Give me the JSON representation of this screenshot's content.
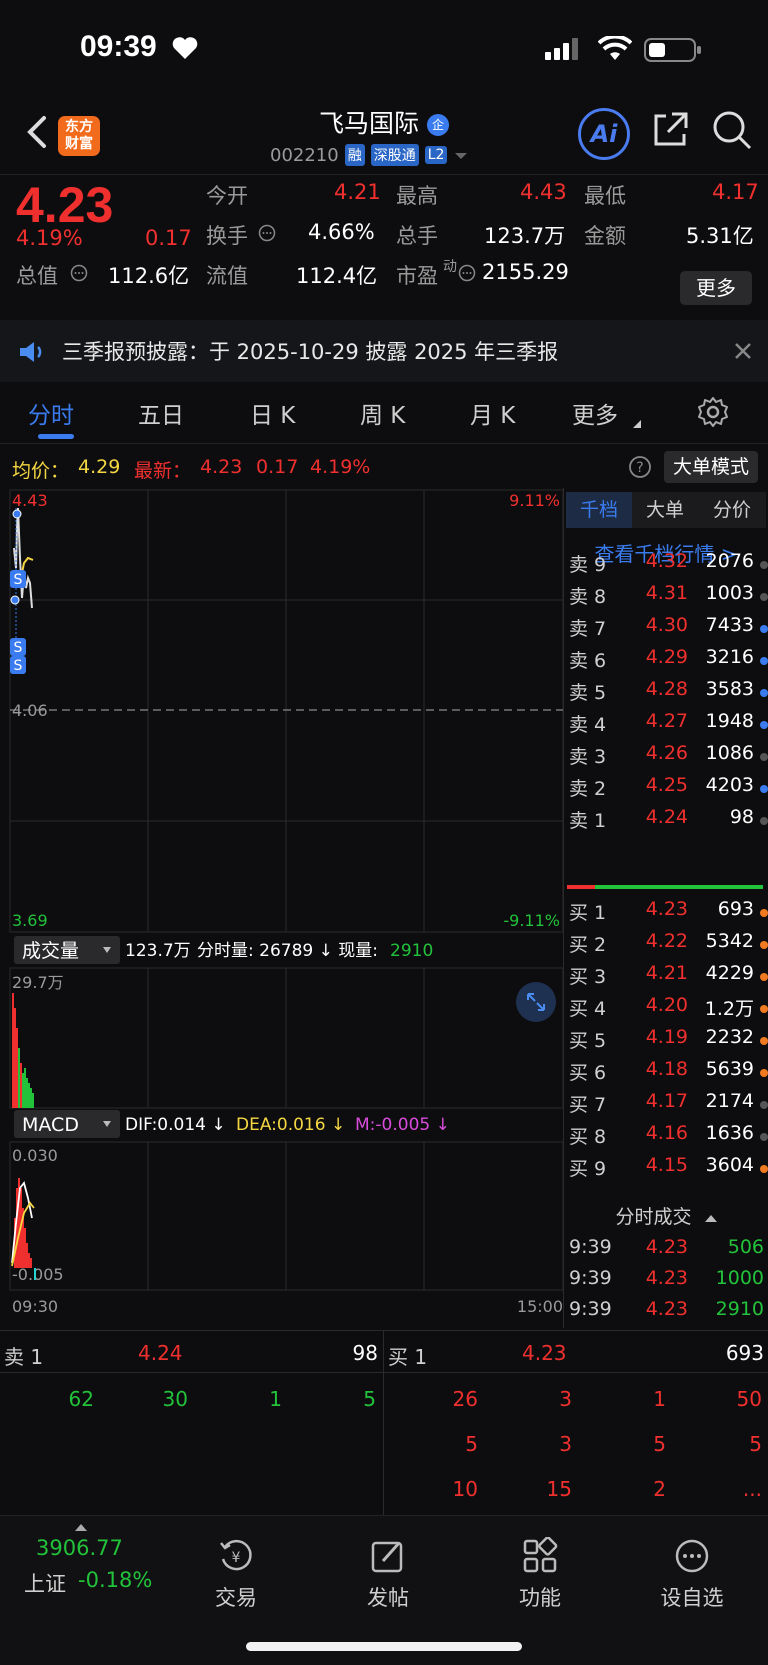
{
  "status": {
    "time": "09:39"
  },
  "header": {
    "logo_line1": "东方",
    "logo_line2": "财富",
    "stock_name": "飞马国际",
    "badge": "企",
    "stock_code": "002210",
    "tags": [
      "融",
      "深股通",
      "L2"
    ],
    "ai_label": "Ai"
  },
  "quote": {
    "price": "4.23",
    "change_pct": "4.19%",
    "change_abs": "0.17",
    "total_value_label": "总值",
    "total_value": "112.6亿",
    "float_value_label": "流值",
    "float_value": "112.4亿",
    "open_label": "今开",
    "open": "4.21",
    "high_label": "最高",
    "high": "4.43",
    "low_label": "最低",
    "low": "4.17",
    "turnover_label": "换手",
    "turnover": "4.66%",
    "volume_label": "总手",
    "volume": "123.7万",
    "amount_label": "金额",
    "amount": "5.31亿",
    "pe_label": "市盈",
    "pe_sup": "动",
    "pe": "2155.29",
    "more_label": "更多"
  },
  "notice": {
    "text": "三季报预披露：于 2025-10-29 披露 2025 年三季报"
  },
  "tabs": [
    "分时",
    "五日",
    "日 K",
    "周 K",
    "月 K",
    "更多"
  ],
  "avg_row": {
    "avg_label": "均价：",
    "avg": "4.29",
    "latest_label": "最新：",
    "latest": "4.23",
    "chg": "0.17",
    "chg_pct": "4.19%",
    "big_order_mode": "大单模式"
  },
  "chart": {
    "price_top": "4.43",
    "pct_top": "9.11%",
    "price_mid": "4.06",
    "price_bottom": "3.69",
    "pct_bottom": "-9.11%",
    "volume_label": "成交量",
    "volume_total": "123.7万",
    "volume_detail": "分时量: 26789 ↓ 现量:",
    "volume_now": "2910",
    "volume_max": "29.7万",
    "macd_label": "MACD",
    "dif": "DIF:0.014 ↓",
    "dea": "DEA:0.016 ↓",
    "m": "M:-0.005 ↓",
    "macd_top": "0.030",
    "macd_bottom": "-0.005",
    "time_start": "09:30",
    "time_end": "15:00"
  },
  "order_book": {
    "tabs": [
      "千档",
      "大单",
      "分价"
    ],
    "view_link": "查看千档行情 >",
    "asks": [
      {
        "label": "卖 9",
        "price": "4.32",
        "vol": "2076",
        "dot": "#555"
      },
      {
        "label": "卖 8",
        "price": "4.31",
        "vol": "1003",
        "dot": "#555"
      },
      {
        "label": "卖 7",
        "price": "4.30",
        "vol": "7433",
        "dot": "#3a7cf0"
      },
      {
        "label": "卖 6",
        "price": "4.29",
        "vol": "3216",
        "dot": "#3a7cf0"
      },
      {
        "label": "卖 5",
        "price": "4.28",
        "vol": "3583",
        "dot": "#3a7cf0"
      },
      {
        "label": "卖 4",
        "price": "4.27",
        "vol": "1948",
        "dot": "#3a7cf0"
      },
      {
        "label": "卖 3",
        "price": "4.26",
        "vol": "1086",
        "dot": "#555"
      },
      {
        "label": "卖 2",
        "price": "4.25",
        "vol": "4203",
        "dot": "#3a7cf0"
      },
      {
        "label": "卖 1",
        "price": "4.24",
        "vol": "98",
        "dot": "#555"
      }
    ],
    "bids": [
      {
        "label": "买 1",
        "price": "4.23",
        "vol": "693",
        "dot": "#f07a20"
      },
      {
        "label": "买 2",
        "price": "4.22",
        "vol": "5342",
        "dot": "#f07a20"
      },
      {
        "label": "买 3",
        "price": "4.21",
        "vol": "4229",
        "dot": "#f07a20"
      },
      {
        "label": "买 4",
        "price": "4.20",
        "vol": "1.2万",
        "dot": "#f07a20"
      },
      {
        "label": "买 5",
        "price": "4.19",
        "vol": "2232",
        "dot": "#f07a20"
      },
      {
        "label": "买 6",
        "price": "4.18",
        "vol": "5639",
        "dot": "#f07a20"
      },
      {
        "label": "买 7",
        "price": "4.17",
        "vol": "2174",
        "dot": "#555"
      },
      {
        "label": "买 8",
        "price": "4.16",
        "vol": "1636",
        "dot": "#555"
      },
      {
        "label": "买 9",
        "price": "4.15",
        "vol": "3604",
        "dot": "#f07a20"
      }
    ],
    "trades_label": "分时成交",
    "trades": [
      {
        "time": "9:39",
        "price": "4.23",
        "vol": "506"
      },
      {
        "time": "9:39",
        "price": "4.23",
        "vol": "1000"
      },
      {
        "time": "9:39",
        "price": "4.23",
        "vol": "2910"
      }
    ]
  },
  "strip": {
    "sell_label": "卖 1",
    "sell_price": "4.24",
    "sell_vol": "98",
    "buy_label": "买 1",
    "buy_price": "4.23",
    "buy_vol": "693",
    "sell_queue": [
      "62",
      "30",
      "1",
      "5"
    ],
    "buy_queue": [
      [
        "26",
        "3",
        "1",
        "50"
      ],
      [
        "5",
        "3",
        "5",
        "5"
      ],
      [
        "10",
        "15",
        "2",
        "..."
      ]
    ]
  },
  "bottom_nav": {
    "index_value": "3906.77",
    "index_name": "上证",
    "index_chg": "-0.18%",
    "items": [
      "交易",
      "发帖",
      "功能",
      "设自选"
    ]
  }
}
